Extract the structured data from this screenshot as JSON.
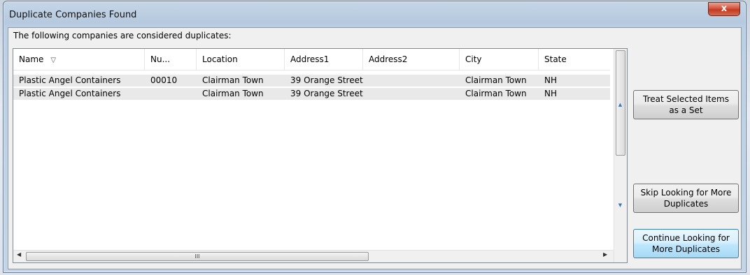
{
  "window": {
    "title": "Duplicate Companies Found",
    "close_glyph": "x"
  },
  "caption": "The following companies are considered duplicates:",
  "columns": [
    {
      "label": "Name",
      "sort_icon": "sort-indicator-icon"
    },
    {
      "label": "Nu..."
    },
    {
      "label": "Location"
    },
    {
      "label": "Address1"
    },
    {
      "label": "Address2"
    },
    {
      "label": "City"
    },
    {
      "label": "State"
    }
  ],
  "rows": [
    {
      "name": "Plastic Angel Containers",
      "number": "00010",
      "location": "Clairman Town",
      "address1": "39 Orange Street",
      "address2": "",
      "city": "Clairman Town",
      "state": "NH"
    },
    {
      "name": "Plastic Angel Containers",
      "number": "",
      "location": "Clairman Town",
      "address1": "39 Orange Street",
      "address2": "",
      "city": "Clairman Town",
      "state": "NH"
    }
  ],
  "scrollbar": {
    "grip": "III"
  },
  "buttons": {
    "treat_set": "Treat Selected Items as a Set",
    "skip": "Skip Looking for More Duplicates",
    "continue": "Continue Looking for More Duplicates"
  },
  "colors": {
    "default_button": "#bee6fd",
    "close_button": "#c23a22"
  }
}
